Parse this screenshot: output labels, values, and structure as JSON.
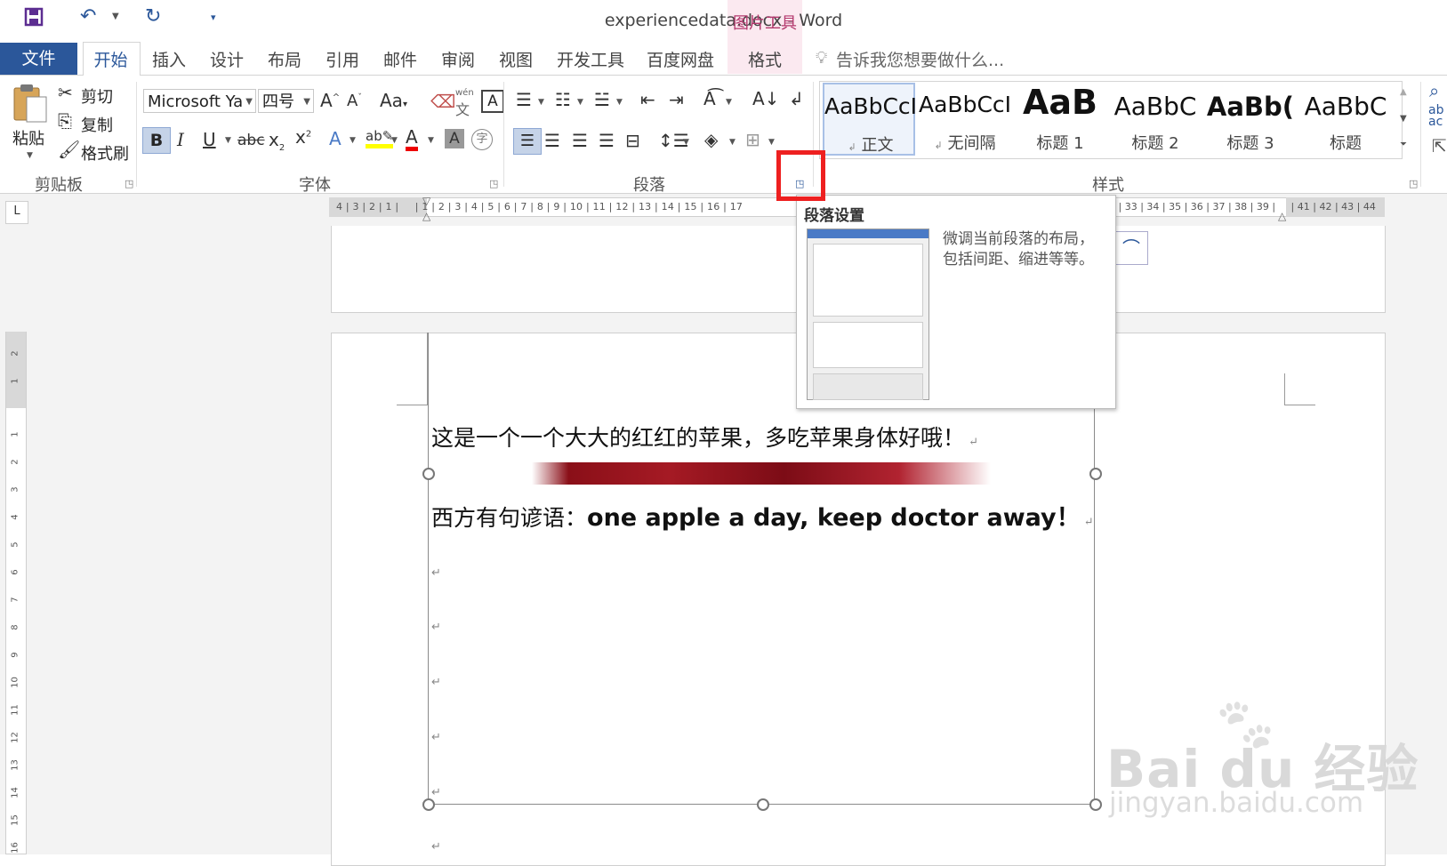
{
  "title_bar": {
    "title": "experiencedata.docx - Word",
    "context_tab_title": "图片工具"
  },
  "tabs": {
    "file": "文件",
    "home": "开始",
    "insert": "插入",
    "design": "设计",
    "layout": "布局",
    "references": "引用",
    "mailings": "邮件",
    "review": "审阅",
    "view": "视图",
    "developer": "开发工具",
    "baidu": "百度网盘",
    "format": "格式",
    "tell_me": "告诉我您想要做什么..."
  },
  "clipboard": {
    "paste": "粘贴",
    "cut": "剪切",
    "copy": "复制",
    "format_painter": "格式刷",
    "group_label": "剪贴板"
  },
  "font": {
    "font_name": "Microsoft Ya",
    "font_size": "四号",
    "group_label": "字体",
    "case_label": "Aa",
    "wen_label": "wén",
    "wen_char": "文"
  },
  "paragraph": {
    "group_label": "段落"
  },
  "styles": {
    "group_label": "样式",
    "items": [
      {
        "sample": "AaBbCcI",
        "name": "正文"
      },
      {
        "sample": "AaBbCcI",
        "name": "无间隔"
      },
      {
        "sample": "AaB",
        "name": "标题 1"
      },
      {
        "sample": "AaBbC",
        "name": "标题 2"
      },
      {
        "sample": "AaBb(",
        "name": "标题 3"
      },
      {
        "sample": "AaBbC",
        "name": "标题"
      }
    ]
  },
  "tooltip": {
    "title": "段落设置",
    "description": "微调当前段落的布局，包括间距、缩进等等。"
  },
  "ruler": {
    "numbers": "4 | 3 | 2 | 1 |     | 1 | 2 | 3 | 4 | 5 | 6 | 7 | 8 | 9 | 10 | 11 | 12 | 13 | 14 | 15 | 16 | 17",
    "numbers_right": "2 | 33 | 34 | 35 | 36 | 37 | 38 | 39 |     | 41 | 42 | 43 | 44",
    "vertical": [
      "2",
      "1",
      "1",
      "2",
      "3",
      "4",
      "5",
      "6",
      "7",
      "8",
      "9",
      "10",
      "11",
      "12",
      "13",
      "14",
      "15",
      "16"
    ]
  },
  "document": {
    "line1": "这是一个一个大大的红红的苹果，多吃苹果身体好哦！",
    "line2_prefix": "西方有句谚语：",
    "line2_bold": "one apple a day, keep doctor away！"
  },
  "watermark": {
    "logo": "Bai du 经验",
    "url": "jingyan.baidu.com"
  },
  "colors": {
    "accent": "#2b579a",
    "context_tab": "#b3386d",
    "highlight_box": "#ee2020"
  }
}
